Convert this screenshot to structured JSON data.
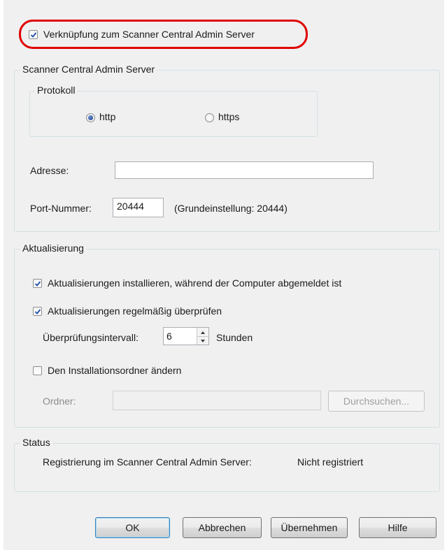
{
  "link_checkbox": {
    "label": "Verknüpfung zum Scanner Central Admin Server",
    "checked": true
  },
  "server_group": {
    "title": "Scanner Central Admin Server",
    "protocol": {
      "title": "Protokoll",
      "options": [
        {
          "label": "http",
          "selected": true
        },
        {
          "label": "https",
          "selected": false
        }
      ]
    },
    "address": {
      "label": "Adresse:",
      "value": ""
    },
    "port": {
      "label": "Port-Nummer:",
      "value": "20444",
      "hint": "(Grundeinstellung: 20444)"
    }
  },
  "update_group": {
    "title": "Aktualisierung",
    "install_while_logged_off": {
      "label": "Aktualisierungen installieren, während der Computer abgemeldet ist",
      "checked": true
    },
    "check_regularly": {
      "label": "Aktualisierungen regelmäßig überprüfen",
      "checked": true
    },
    "interval": {
      "label": "Überprüfungsintervall:",
      "value": "6",
      "unit": "Stunden"
    },
    "change_folder": {
      "label": "Den Installationsordner ändern",
      "checked": false
    },
    "folder": {
      "label": "Ordner:",
      "value": "",
      "browse_label": "Durchsuchen..."
    }
  },
  "status_group": {
    "title": "Status",
    "label": "Registrierung im Scanner Central Admin Server:",
    "value": "Nicht registriert"
  },
  "buttons": {
    "ok": "OK",
    "cancel": "Abbrechen",
    "apply": "Übernehmen",
    "help": "Hilfe"
  },
  "colors": {
    "highlight": "#e00000",
    "dialog_bg": "#f0f0f0",
    "check_mark": "#1f4fa8"
  }
}
